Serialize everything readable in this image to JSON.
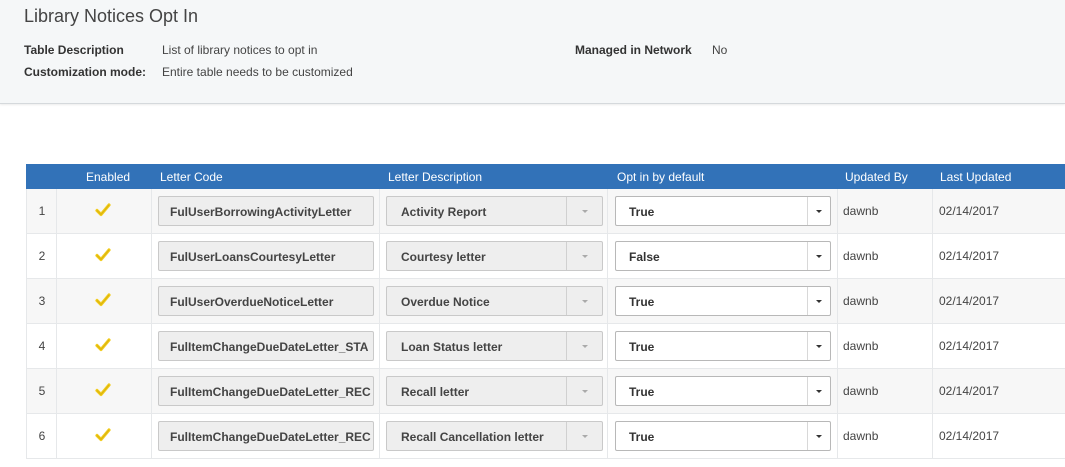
{
  "page": {
    "title": "Library Notices Opt In",
    "table_description_label": "Table Description",
    "table_description_value": "List of library notices to opt in",
    "customization_mode_label": "Customization mode:",
    "customization_mode_value": "Entire table needs to be customized",
    "managed_in_network_label": "Managed in Network",
    "managed_in_network_value": "No"
  },
  "table": {
    "headers": {
      "enabled": "Enabled",
      "letter_code": "Letter Code",
      "letter_description": "Letter Description",
      "opt_in_by_default": "Opt in by default",
      "updated_by": "Updated By",
      "last_updated": "Last Updated"
    },
    "rows": [
      {
        "num": "1",
        "enabled": true,
        "code": "FulUserBorrowingActivityLetter",
        "description": "Activity Report",
        "opt_in": "True",
        "updated_by": "dawnb",
        "last_updated": "02/14/2017"
      },
      {
        "num": "2",
        "enabled": true,
        "code": "FulUserLoansCourtesyLetter",
        "description": "Courtesy letter",
        "opt_in": "False",
        "updated_by": "dawnb",
        "last_updated": "02/14/2017"
      },
      {
        "num": "3",
        "enabled": true,
        "code": "FulUserOverdueNoticeLetter",
        "description": "Overdue Notice",
        "opt_in": "True",
        "updated_by": "dawnb",
        "last_updated": "02/14/2017"
      },
      {
        "num": "4",
        "enabled": true,
        "code": "FulItemChangeDueDateLetter_STA",
        "description": "Loan Status letter",
        "opt_in": "True",
        "updated_by": "dawnb",
        "last_updated": "02/14/2017"
      },
      {
        "num": "5",
        "enabled": true,
        "code": "FulItemChangeDueDateLetter_REC",
        "description": "Recall letter",
        "opt_in": "True",
        "updated_by": "dawnb",
        "last_updated": "02/14/2017"
      },
      {
        "num": "6",
        "enabled": true,
        "code": "FulItemChangeDueDateLetter_REC",
        "description": "Recall Cancellation letter",
        "opt_in": "True",
        "updated_by": "dawnb",
        "last_updated": "02/14/2017"
      }
    ]
  },
  "icons": {
    "enabled": "checkmark-icon",
    "dropdown": "chevron-down-icon"
  },
  "colors": {
    "header_bg": "#3272b8",
    "check": "#f2cc1d",
    "panel_bg": "#f5f7f8"
  }
}
